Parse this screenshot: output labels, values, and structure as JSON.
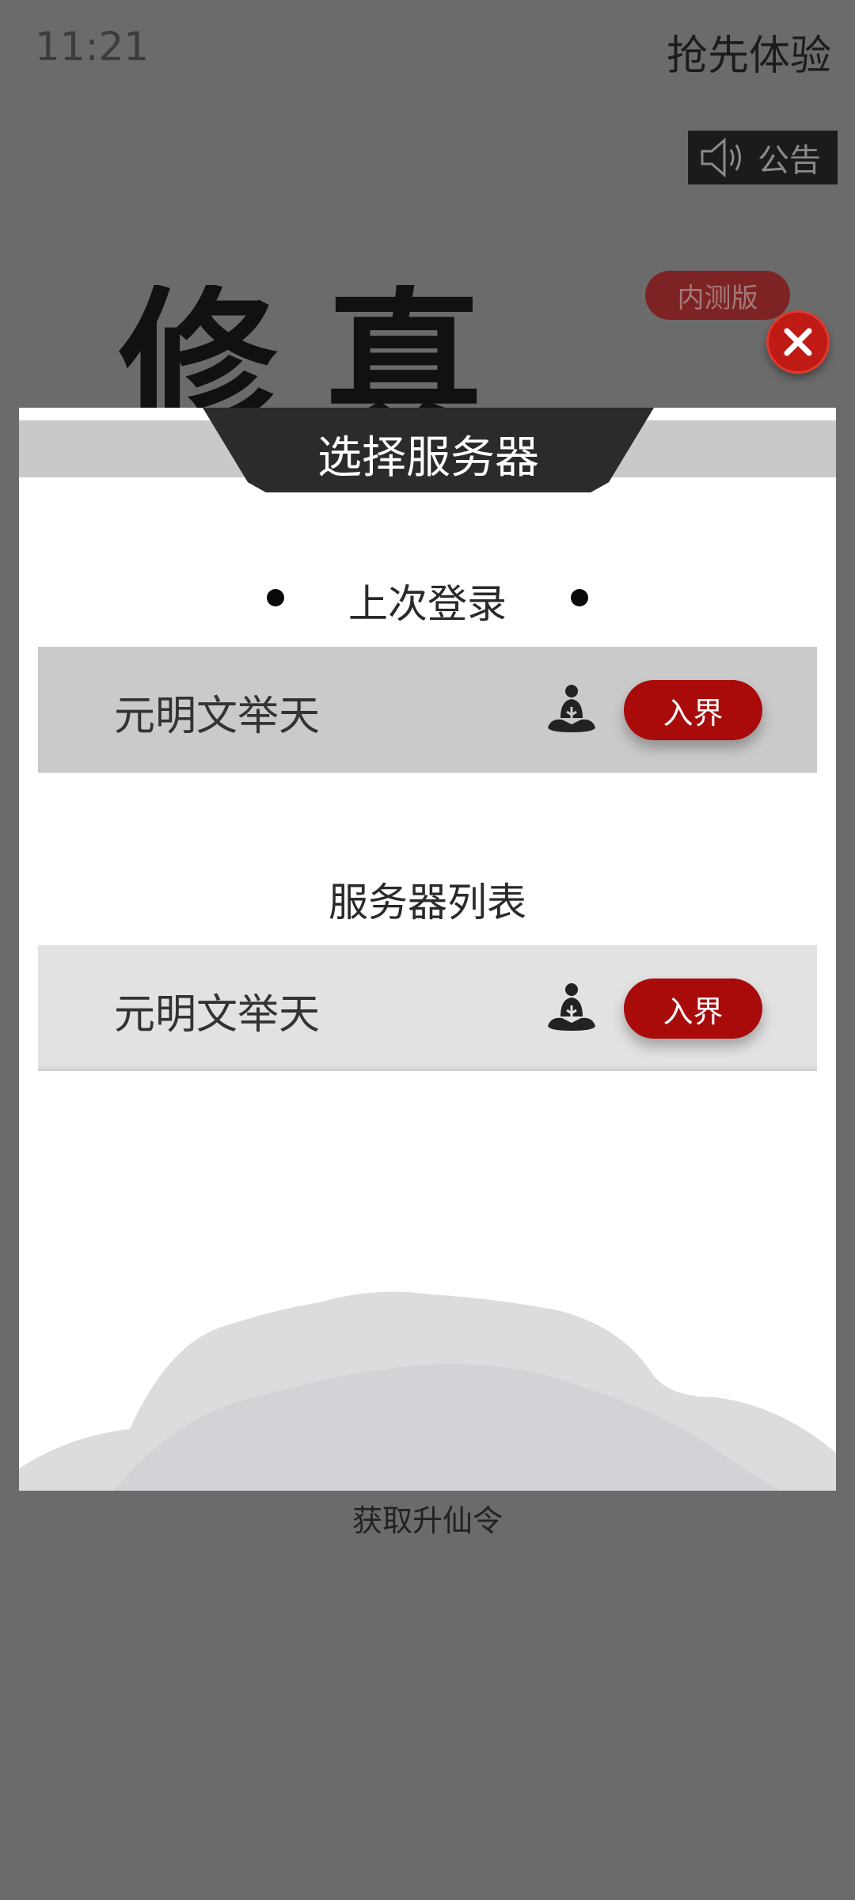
{
  "status_bar": {
    "time": "11:21"
  },
  "top_bar": {
    "early_access": "抢先体验",
    "notice": "公告"
  },
  "beta_badge": "内测版",
  "title_art": "修真界",
  "dialog": {
    "title": "选择服务器",
    "last_login": {
      "heading": "上次登录",
      "server": {
        "name": "元明文举天",
        "enter_label": "入界"
      }
    },
    "server_list": {
      "heading": "服务器列表",
      "servers": [
        {
          "name": "元明文举天",
          "enter_label": "入界"
        }
      ]
    }
  },
  "footer": {
    "get_token": "获取升仙令"
  },
  "colors": {
    "accent_red": "#a90b0b",
    "dialog_title_bg": "#2b2b2b"
  },
  "icons": {
    "notice": "speaker-icon",
    "close": "close-icon",
    "player": "meditating-figure-icon"
  }
}
